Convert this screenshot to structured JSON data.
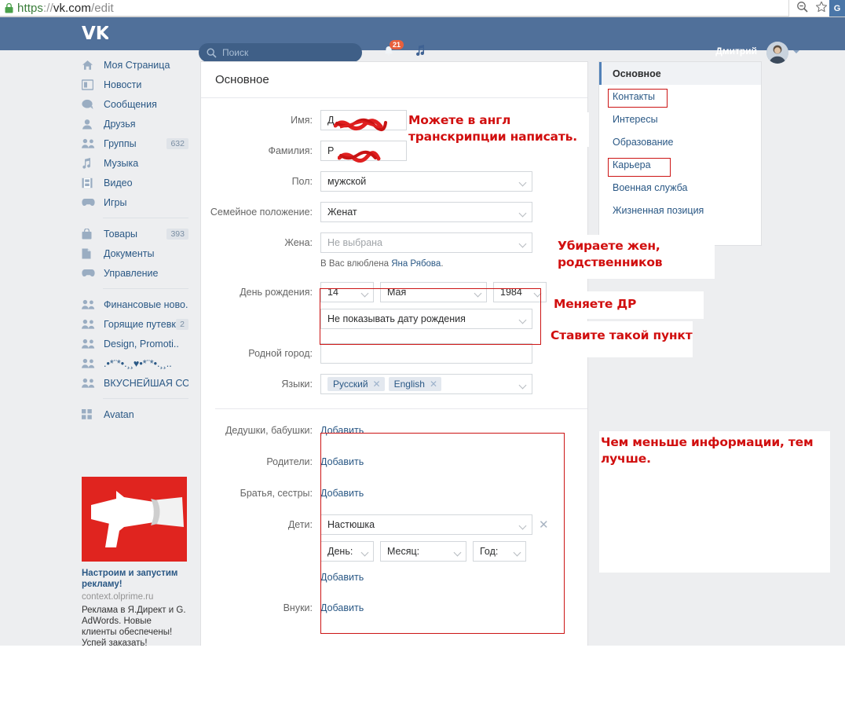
{
  "browser": {
    "url_scheme": "https",
    "url_sep": "://",
    "url_host": "vk.com",
    "url_path": "/edit",
    "lock_icon": "lock-icon",
    "zoom_out_icon": "zoom-out-icon",
    "bookmark_icon": "star-icon",
    "extension_label": "G"
  },
  "topbar": {
    "logo": "VK",
    "search_placeholder": "Поиск",
    "search_icon": "search-icon",
    "notifications_icon": "bell-icon",
    "notifications_count": "21",
    "music_icon": "music-note-icon",
    "user_name": "Дмитрий",
    "avatar": "user-avatar",
    "caret_icon": "chevron-down-icon"
  },
  "sidebar": {
    "items": [
      {
        "label": "Моя Страница",
        "icon": "home-icon",
        "count": ""
      },
      {
        "label": "Новости",
        "icon": "news-icon",
        "count": ""
      },
      {
        "label": "Сообщения",
        "icon": "message-icon",
        "count": ""
      },
      {
        "label": "Друзья",
        "icon": "person-icon",
        "count": ""
      },
      {
        "label": "Группы",
        "icon": "people-icon",
        "count": "632"
      },
      {
        "label": "Музыка",
        "icon": "music-note-icon",
        "count": ""
      },
      {
        "label": "Видео",
        "icon": "video-icon",
        "count": ""
      },
      {
        "label": "Игры",
        "icon": "gamepad-icon",
        "count": ""
      }
    ],
    "items2": [
      {
        "label": "Товары",
        "icon": "bag-icon",
        "count": "393"
      },
      {
        "label": "Документы",
        "icon": "document-icon",
        "count": ""
      },
      {
        "label": "Управление",
        "icon": "gamepad-icon",
        "count": ""
      }
    ],
    "items3": [
      {
        "label": "Финансовые ново..",
        "icon": "people-icon",
        "count": ""
      },
      {
        "label": "Горящие путевки..",
        "icon": "people-icon",
        "count": "2"
      },
      {
        "label": "Design, Promoti..",
        "icon": "people-icon",
        "count": ""
      },
      {
        "label": ".•*¨*•.¸¸♥•*¨*•.¸¸..",
        "icon": "people-icon",
        "count": ""
      },
      {
        "label": "ВКУСНЕЙШАЯ СОЛ...",
        "icon": "people-icon",
        "count": ""
      }
    ],
    "items4": [
      {
        "label": "Avatan",
        "icon": "apps-icon",
        "count": ""
      }
    ]
  },
  "ad": {
    "image_alt": "megaphone-illustration",
    "title": "Настроим и запустим рекламу!",
    "domain": "context.olprime.ru",
    "description": "Реклама в Я.Директ и G. AdWords. Новые клиенты обеспечены! Успей заказать!"
  },
  "form": {
    "panel_title": "Основное",
    "labels": {
      "first_name": "Имя:",
      "last_name": "Фамилия:",
      "gender": "Пол:",
      "marital": "Семейное положение:",
      "wife": "Жена:",
      "birthday": "День рождения:",
      "hometown": "Родной город:",
      "languages": "Языки:",
      "grandparents": "Дедушки, бабушки:",
      "parents": "Родители:",
      "siblings": "Братья, сестры:",
      "children": "Дети:",
      "grandchildren": "Внуки:"
    },
    "values": {
      "first_name": "Д",
      "last_name": "Р",
      "gender": "мужской",
      "marital": "Женат",
      "wife": "Не выбрана",
      "birthday_day": "14",
      "birthday_month": "Мая",
      "birthday_year": "1984",
      "birthday_visibility": "Не показывать дату рождения",
      "hometown": "",
      "child_name": "Настюшка",
      "child_day": "День:",
      "child_month": "Месяц:",
      "child_year": "Год:"
    },
    "language_tags": [
      "Русский",
      "English"
    ],
    "love_hint_prefix": "В Вас влюблена ",
    "love_hint_link": "Яна Рябова",
    "love_hint_suffix": ".",
    "add_label": "Добавить",
    "remove_icon": "close-icon"
  },
  "rightnav": {
    "items": [
      {
        "label": "Основное",
        "active": true
      },
      {
        "label": "Контакты",
        "active": false
      },
      {
        "label": "Интересы",
        "active": false
      },
      {
        "label": "Образование",
        "active": false
      },
      {
        "label": "Карьера",
        "active": false
      },
      {
        "label": "Военная служба",
        "active": false
      },
      {
        "label": "Жизненная позиция",
        "active": false
      }
    ]
  },
  "annotations": {
    "a1_line1": "Можете в англ",
    "a1_line2": "транскрипции написать.",
    "a2_line1": "Убираете жен,",
    "a2_line2": "родственников",
    "a3": "Меняете ДР",
    "a4": "Ставите такой пункт",
    "a5_line1": "Чем меньше информации, тем",
    "a5_line2": "лучше."
  },
  "colors": {
    "vk_blue": "#50709a",
    "link_blue": "#2a5885",
    "annotation_red": "#d10f0f",
    "badge_orange": "#e8603c",
    "ad_red": "#e0241f"
  }
}
